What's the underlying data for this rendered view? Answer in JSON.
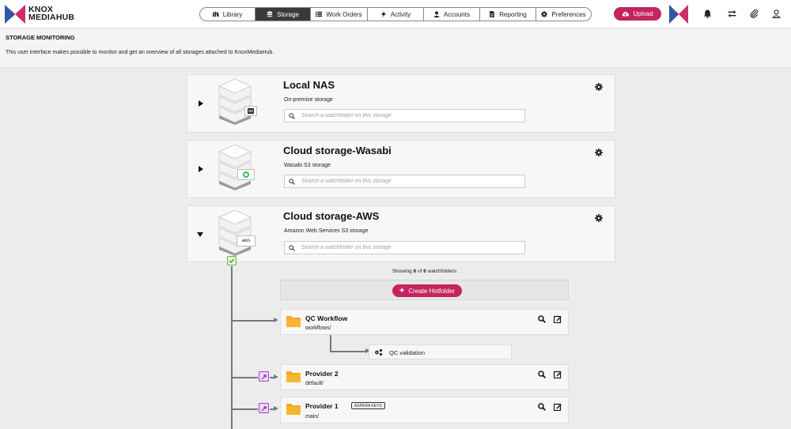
{
  "brand": {
    "line1": "KNOX",
    "line2": "MEDIAHUB"
  },
  "colors": {
    "accent": "#c4245f",
    "logo_blue": "#2b5aa8",
    "logo_pink": "#d02a6b",
    "folder": "#f5a623",
    "key_badge": "#a542c2",
    "check": "#6fb04a"
  },
  "nav": {
    "items": [
      {
        "label": "Library",
        "icon": "books-icon"
      },
      {
        "label": "Storage",
        "icon": "database-icon"
      },
      {
        "label": "Work Orders",
        "icon": "list-icon"
      },
      {
        "label": "Activity",
        "icon": "bolt-icon"
      },
      {
        "label": "Accounts",
        "icon": "user-icon"
      },
      {
        "label": "Reporting",
        "icon": "report-icon"
      },
      {
        "label": "Preferences",
        "icon": "gear-icon"
      }
    ],
    "active": "Storage"
  },
  "upload": {
    "label": "Upload",
    "icon": "cloud-upload-icon"
  },
  "top_icons": [
    "bell-icon",
    "transfer-icon",
    "paperclip-icon",
    "user-icon"
  ],
  "page": {
    "title": "STORAGE MONITORING",
    "description": "This user interface makes possible to monitor and get an overview of all storages attached to KnoxMediaHub."
  },
  "storages": [
    {
      "title": "Local NAS",
      "subtitle": "On-premise storage",
      "badge": "nas-icon",
      "expanded": false,
      "search_placeholder": "Search a watchfolder on this storage"
    },
    {
      "title": "Cloud storage-Wasabi",
      "subtitle": "Wasabi S3 storage",
      "badge": "wasabi-icon",
      "expanded": false,
      "search_placeholder": "Search a watchfolder on this storage"
    },
    {
      "title": "Cloud storage-AWS",
      "subtitle": "Amazon Web Services S3 storage",
      "badge_text": "aws",
      "expanded": true,
      "search_placeholder": "Search a watchfolder on this storage"
    }
  ],
  "watchfolders": {
    "showing_prefix": "Showing ",
    "shown": "6",
    "of_word": " of ",
    "total": "6",
    "suffix": " watchfolders",
    "create_label": "Create Hotfolder",
    "items": [
      {
        "name": "QC Workflow",
        "path": "workflows/",
        "sub": {
          "label": "QC validation",
          "icon": "cogs-icon"
        }
      },
      {
        "name": "Provider 2",
        "path": "default/",
        "key": true
      },
      {
        "name": "Provider 1",
        "path": "main/",
        "key": true,
        "tag": "ASPERA KEYS"
      }
    ]
  }
}
